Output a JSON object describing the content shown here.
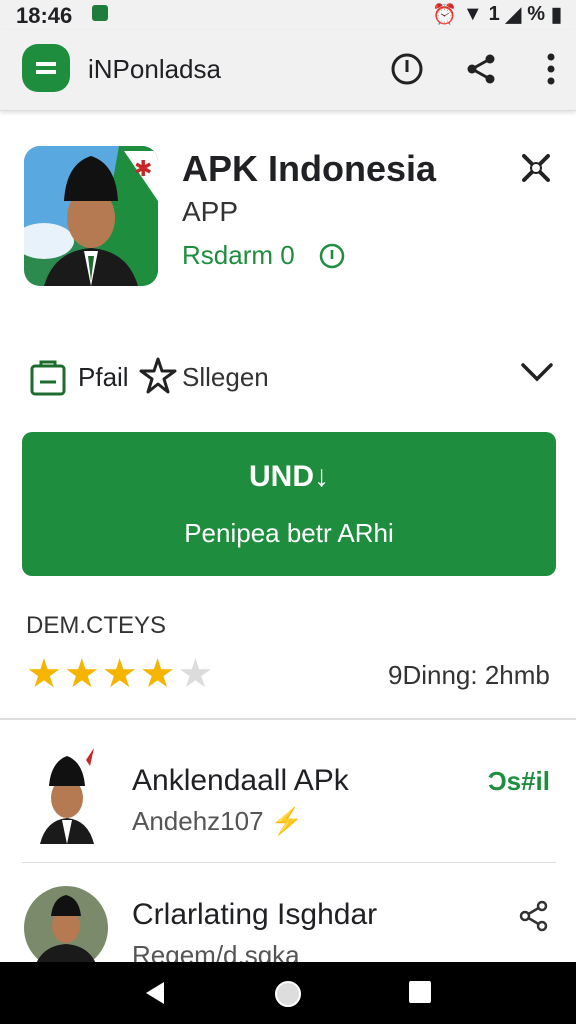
{
  "status_bar": {
    "time": "18:46",
    "battery": "1",
    "signal_text": "%"
  },
  "app_bar": {
    "title": "iNPonladsa",
    "icons": [
      "info-icon",
      "share-icon",
      "more-vert-icon"
    ]
  },
  "header": {
    "app_name": "APK Indonesia",
    "app_subtitle": "APP",
    "developer": "Rsdarm 0",
    "icons": [
      "close-icon",
      "info-circle-icon"
    ]
  },
  "meta": {
    "item1_label": "Pfail",
    "item2_label": "Sllegen"
  },
  "install_button": {
    "title": "UND↓",
    "subtitle": "Penipea betr ARhi"
  },
  "rating": {
    "label": "DEM.CTEYS",
    "stars": 4,
    "max_stars": 5,
    "size_text": "9Dinng: 2hmb"
  },
  "list": [
    {
      "name": "Anklendaall APk",
      "sub": "Andehz107",
      "right": "Ɔs#il",
      "right_icon": "status-icon"
    },
    {
      "name": "Crlarlating Isghdar",
      "sub": "Regem/d.sgka",
      "right_icon": "share-icon"
    }
  ],
  "colors": {
    "accent": "#1e8e3e",
    "star": "#f5b400",
    "star_empty": "#dcdcdc"
  }
}
